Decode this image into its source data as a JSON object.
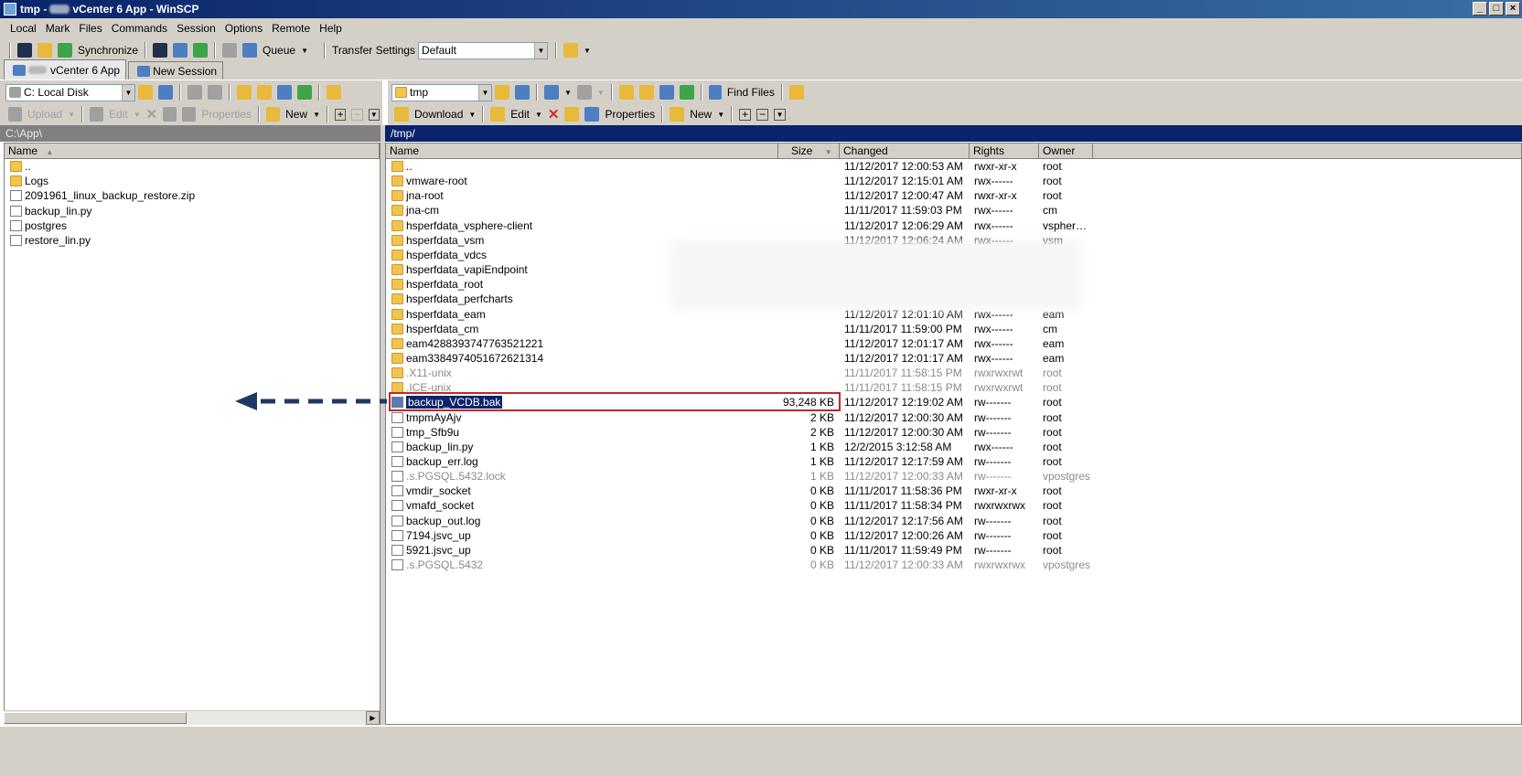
{
  "window": {
    "title_prefix": "tmp - ",
    "title_suffix": "vCenter 6 App - WinSCP",
    "buttons": [
      "_",
      "□",
      "×"
    ]
  },
  "menu": [
    "Local",
    "Mark",
    "Files",
    "Commands",
    "Session",
    "Options",
    "Remote",
    "Help"
  ],
  "toolbar": {
    "synchronize": "Synchronize",
    "queue": "Queue",
    "transfer_settings_label": "Transfer Settings",
    "transfer_settings_value": "Default"
  },
  "tabs": [
    {
      "label": "vCenter 6 App"
    },
    {
      "label": "New Session"
    }
  ],
  "local": {
    "drive": "C: Local Disk",
    "upload": "Upload",
    "edit": "Edit",
    "properties": "Properties",
    "new": "New",
    "path": "C:\\App\\",
    "col_name": "Name",
    "files": [
      {
        "name": "..",
        "type": "updir"
      },
      {
        "name": "Logs",
        "type": "folder"
      },
      {
        "name": "2091961_linux_backup_restore.zip",
        "type": "zip"
      },
      {
        "name": "backup_lin.py",
        "type": "file"
      },
      {
        "name": "postgres",
        "type": "file"
      },
      {
        "name": "restore_lin.py",
        "type": "file"
      }
    ]
  },
  "remote": {
    "dir": "tmp",
    "find_files": "Find Files",
    "download": "Download",
    "edit": "Edit",
    "properties": "Properties",
    "new": "New",
    "path": "/tmp/",
    "columns": {
      "name": "Name",
      "size": "Size",
      "changed": "Changed",
      "rights": "Rights",
      "owner": "Owner"
    },
    "files": [
      {
        "name": "..",
        "size": "",
        "changed": "11/12/2017 12:00:53 AM",
        "rights": "rwxr-xr-x",
        "owner": "root",
        "type": "updir",
        "dim": false
      },
      {
        "name": "vmware-root",
        "size": "",
        "changed": "11/12/2017 12:15:01 AM",
        "rights": "rwx------",
        "owner": "root",
        "type": "folder",
        "dim": false
      },
      {
        "name": "jna-root",
        "size": "",
        "changed": "11/12/2017 12:00:47 AM",
        "rights": "rwxr-xr-x",
        "owner": "root",
        "type": "folder",
        "dim": false
      },
      {
        "name": "jna-cm",
        "size": "",
        "changed": "11/11/2017 11:59:03 PM",
        "rights": "rwx------",
        "owner": "cm",
        "type": "folder",
        "dim": false
      },
      {
        "name": "hsperfdata_vsphere-client",
        "size": "",
        "changed": "11/12/2017 12:06:29 AM",
        "rights": "rwx------",
        "owner": "vspher…",
        "type": "folder",
        "dim": false
      },
      {
        "name": "hsperfdata_vsm",
        "size": "",
        "changed": "11/12/2017 12:06:24 AM",
        "rights": "rwx------",
        "owner": "vsm",
        "type": "folder",
        "dim": false
      },
      {
        "name": "hsperfdata_vdcs",
        "size": "",
        "changed": "",
        "rights": "",
        "owner": "",
        "type": "folder",
        "dim": false
      },
      {
        "name": "hsperfdata_vapiEndpoint",
        "size": "",
        "changed": "",
        "rights": "",
        "owner": "",
        "type": "folder",
        "dim": false
      },
      {
        "name": "hsperfdata_root",
        "size": "",
        "changed": "",
        "rights": "",
        "owner": "",
        "type": "folder",
        "dim": false
      },
      {
        "name": "hsperfdata_perfcharts",
        "size": "",
        "changed": "",
        "rights": "",
        "owner": "",
        "type": "folder",
        "dim": false
      },
      {
        "name": "hsperfdata_eam",
        "size": "",
        "changed": "11/12/2017 12:01:10 AM",
        "rights": "rwx------",
        "owner": "eam",
        "type": "folder",
        "dim": false
      },
      {
        "name": "hsperfdata_cm",
        "size": "",
        "changed": "11/11/2017 11:59:00 PM",
        "rights": "rwx------",
        "owner": "cm",
        "type": "folder",
        "dim": false
      },
      {
        "name": "eam4288393747763521221",
        "size": "",
        "changed": "11/12/2017 12:01:17 AM",
        "rights": "rwx------",
        "owner": "eam",
        "type": "folder",
        "dim": false
      },
      {
        "name": "eam3384974051672621314",
        "size": "",
        "changed": "11/12/2017 12:01:17 AM",
        "rights": "rwx------",
        "owner": "eam",
        "type": "folder",
        "dim": false
      },
      {
        "name": ".X11-unix",
        "size": "",
        "changed": "11/11/2017 11:58:15 PM",
        "rights": "rwxrwxrwt",
        "owner": "root",
        "type": "folder",
        "dim": true
      },
      {
        "name": ".ICE-unix",
        "size": "",
        "changed": "11/11/2017 11:58:15 PM",
        "rights": "rwxrwxrwt",
        "owner": "root",
        "type": "folder",
        "dim": true
      },
      {
        "name": "backup_VCDB.bak",
        "size": "93,248 KB",
        "changed": "11/12/2017 12:19:02 AM",
        "rights": "rw-------",
        "owner": "root",
        "type": "file",
        "dim": false,
        "selected": true
      },
      {
        "name": "tmpmAyAjv",
        "size": "2 KB",
        "changed": "11/12/2017 12:00:30 AM",
        "rights": "rw-------",
        "owner": "root",
        "type": "file",
        "dim": false
      },
      {
        "name": "tmp_Sfb9u",
        "size": "2 KB",
        "changed": "11/12/2017 12:00:30 AM",
        "rights": "rw-------",
        "owner": "root",
        "type": "file",
        "dim": false
      },
      {
        "name": "backup_lin.py",
        "size": "1 KB",
        "changed": "12/2/2015 3:12:58 AM",
        "rights": "rwx------",
        "owner": "root",
        "type": "file",
        "dim": false
      },
      {
        "name": "backup_err.log",
        "size": "1 KB",
        "changed": "11/12/2017 12:17:59 AM",
        "rights": "rw-------",
        "owner": "root",
        "type": "log",
        "dim": false
      },
      {
        "name": ".s.PGSQL.5432.lock",
        "size": "1 KB",
        "changed": "11/12/2017 12:00:33 AM",
        "rights": "rw-------",
        "owner": "vpostgres",
        "type": "file",
        "dim": true
      },
      {
        "name": "vmdir_socket",
        "size": "0 KB",
        "changed": "11/11/2017 11:58:36 PM",
        "rights": "rwxr-xr-x",
        "owner": "root",
        "type": "file",
        "dim": false
      },
      {
        "name": "vmafd_socket",
        "size": "0 KB",
        "changed": "11/11/2017 11:58:34 PM",
        "rights": "rwxrwxrwx",
        "owner": "root",
        "type": "file",
        "dim": false
      },
      {
        "name": "backup_out.log",
        "size": "0 KB",
        "changed": "11/12/2017 12:17:56 AM",
        "rights": "rw-------",
        "owner": "root",
        "type": "log",
        "dim": false
      },
      {
        "name": "7194.jsvc_up",
        "size": "0 KB",
        "changed": "11/12/2017 12:00:26 AM",
        "rights": "rw-------",
        "owner": "root",
        "type": "file",
        "dim": false
      },
      {
        "name": "5921.jsvc_up",
        "size": "0 KB",
        "changed": "11/11/2017 11:59:49 PM",
        "rights": "rw-------",
        "owner": "root",
        "type": "file",
        "dim": false
      },
      {
        "name": ".s.PGSQL.5432",
        "size": "0 KB",
        "changed": "11/12/2017 12:00:33 AM",
        "rights": "rwxrwxrwx",
        "owner": "vpostgres",
        "type": "file",
        "dim": true
      }
    ]
  },
  "colors": {
    "accent": "#0a246a",
    "highlight_box": "#c0272d",
    "arrow": "#1f3864"
  }
}
